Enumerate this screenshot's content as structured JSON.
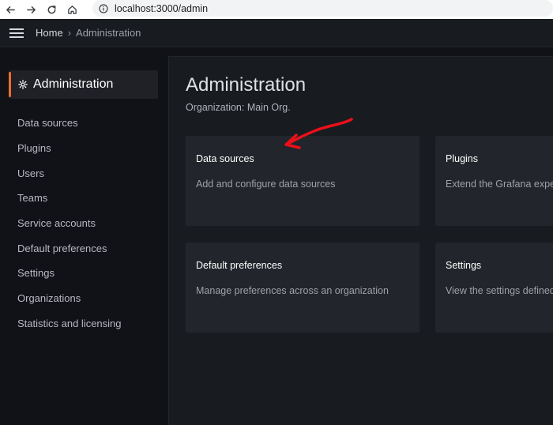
{
  "browser": {
    "url": "localhost:3000/admin"
  },
  "topbar": {
    "home": "Home",
    "current": "Administration"
  },
  "sidebar": {
    "header": "Administration",
    "items": [
      {
        "label": "Data sources"
      },
      {
        "label": "Plugins"
      },
      {
        "label": "Users"
      },
      {
        "label": "Teams"
      },
      {
        "label": "Service accounts"
      },
      {
        "label": "Default preferences"
      },
      {
        "label": "Settings"
      },
      {
        "label": "Organizations"
      },
      {
        "label": "Statistics and licensing"
      }
    ]
  },
  "main": {
    "title": "Administration",
    "subtitle": "Organization: Main Org.",
    "cards": [
      {
        "title": "Data sources",
        "description": "Add and configure data sources"
      },
      {
        "title": "Plugins",
        "description": "Extend the Grafana experience with plugins"
      },
      {
        "title": "Default preferences",
        "description": "Manage preferences across an organization"
      },
      {
        "title": "Settings",
        "description": "View the settings defined in your Grafana config"
      }
    ]
  },
  "annotation": {
    "arrow_color": "#e8101a"
  },
  "theme": {
    "accent": "#f46a2d"
  }
}
